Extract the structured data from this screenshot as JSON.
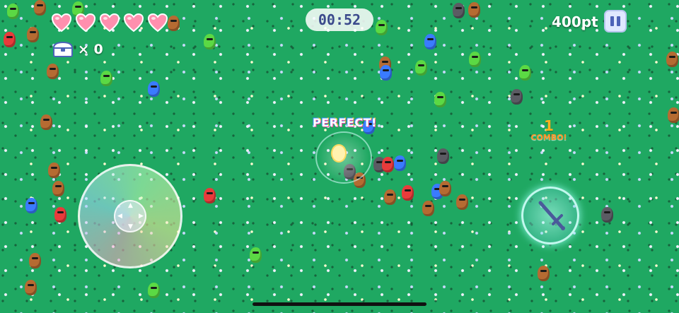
{
  "hud": {
    "hearts": 5,
    "chest_count": "× 0",
    "timer": "00:52",
    "score": "400pt"
  },
  "feedback": {
    "perfect": "PERFECT!",
    "combo_count": "1",
    "combo_label": "COMBO!"
  },
  "icons": [
    "heart-icon",
    "treasure-chest-icon",
    "pause-icon",
    "sword-icon",
    "joystick-arrow-icon"
  ],
  "colors": {
    "grass": "#1fa862",
    "heart": "#ff8fae",
    "timer_text": "#3b4a8c",
    "combo": "#ffb21e",
    "pause_bg": "#dfe8ff"
  }
}
